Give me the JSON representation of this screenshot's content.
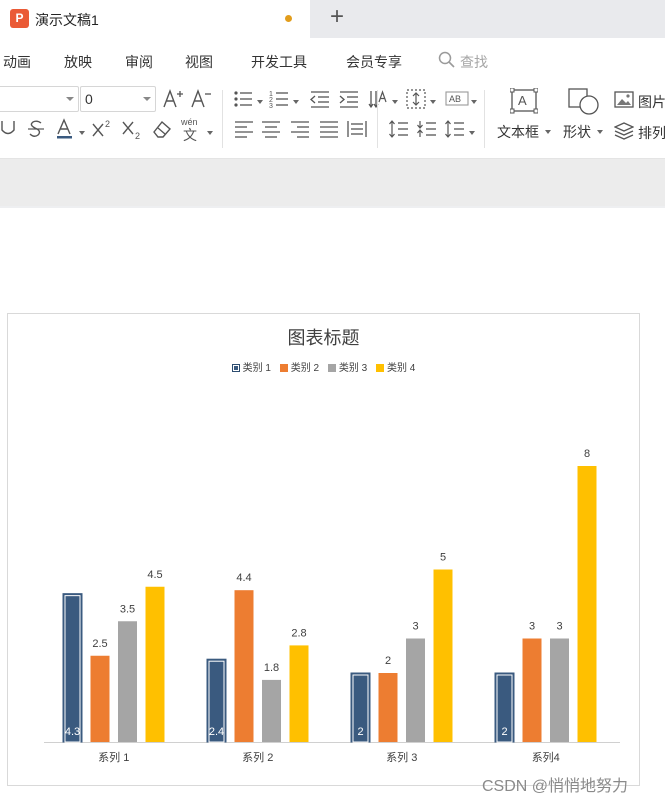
{
  "titlebar": {
    "app_icon_letter": "P",
    "doc_title": "演示文稿1",
    "new_tab_symbol": "+"
  },
  "menu": {
    "items": [
      "动画",
      "放映",
      "审阅",
      "视图",
      "开发工具",
      "会员专享"
    ],
    "search_label": "查找"
  },
  "toolbar": {
    "font_size_value": "0",
    "textbox_label": "文本框",
    "shape_label": "形状",
    "picture_label": "图片",
    "arrange_label": "排列",
    "phonetic_label": "wén",
    "icons": [
      "font-name-input",
      "font-size-input",
      "increase-font-icon",
      "decrease-font-icon",
      "bullet-list-icon",
      "number-list-icon",
      "decrease-indent-icon",
      "increase-indent-icon",
      "text-direction-icon",
      "align-text-icon",
      "text-fit-icon",
      "underline-icon",
      "strikethrough-icon",
      "font-color-icon",
      "superscript-icon",
      "subscript-icon",
      "clear-format-icon",
      "phonetic-icon",
      "align-left-icon",
      "align-center-icon",
      "align-right-icon",
      "justify-icon",
      "distribute-icon",
      "line-spacing-icon",
      "paragraph-spacing-before-icon",
      "paragraph-spacing-after-icon",
      "textbox-icon",
      "shape-icon",
      "picture-icon",
      "arrange-icon"
    ]
  },
  "chart_data": {
    "type": "bar",
    "title": "图表标题",
    "categories": [
      "系列 1",
      "系列 2",
      "系列 3",
      "系列4"
    ],
    "series": [
      {
        "name": "类别 1",
        "values": [
          4.3,
          2.4,
          2,
          2
        ],
        "color": "#3a5a7f",
        "label_inside": true
      },
      {
        "name": "类别 2",
        "values": [
          2.5,
          4.4,
          2,
          3
        ],
        "color": "#ed7d31",
        "label_inside": false
      },
      {
        "name": "类别 3",
        "values": [
          3.5,
          1.8,
          3,
          3
        ],
        "color": "#a5a5a5",
        "label_inside": false
      },
      {
        "name": "类别 4",
        "values": [
          4.5,
          2.8,
          5,
          8
        ],
        "color": "#ffc000",
        "label_inside": false
      }
    ],
    "ylim": [
      0,
      9
    ],
    "grid": false,
    "legend": "top"
  },
  "watermark": "CSDN @悄悄地努力"
}
